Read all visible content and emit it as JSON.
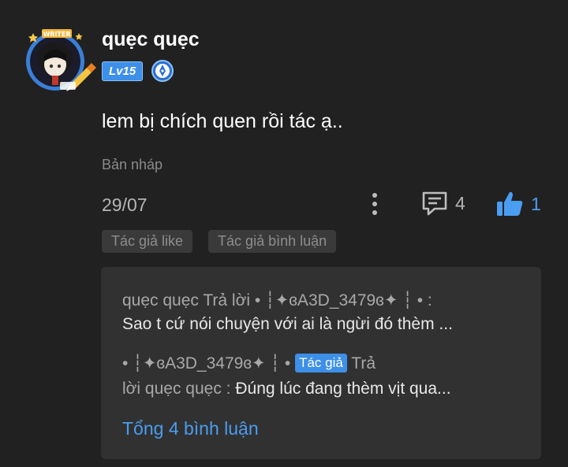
{
  "user": {
    "name": "quẹc quẹc",
    "avatar_badge_text": "WRITER",
    "level": "Lv15"
  },
  "comment": {
    "text": "lem bị chích quen rồi tác ạ..",
    "draft_label": "Bản nháp",
    "date": "29/07",
    "reply_count": "4",
    "like_count": "1"
  },
  "tags": [
    "Tác giả like",
    "Tác giả bình luận"
  ],
  "replies": {
    "reply1": {
      "prefix": "quẹc quẹc Trả lời  • ┆✦ɞA3D_3479ɞ✦ ┆ • :",
      "body": "Sao t cứ nói chuyện với ai là ngừi đó thèm ..."
    },
    "reply2": {
      "prefix": "• ┆✦ɞA3D_3479ɞ✦ ┆ • ",
      "author_tag": "Tác giả",
      "suffix": " Trả",
      "body_prefix": "lời quẹc quẹc : ",
      "body": "Đúng lúc đang thèm vịt qua..."
    },
    "total_label": "Tổng 4 bình luận"
  },
  "colors": {
    "background": "#212121",
    "accent": "#4a9df0",
    "badge": "#3d8fe8",
    "reply_box": "#313131"
  },
  "icons": {
    "more": "more-vertical-icon",
    "reply": "comment-icon",
    "like": "thumbs-up-icon",
    "role": "writer-pen-icon"
  }
}
